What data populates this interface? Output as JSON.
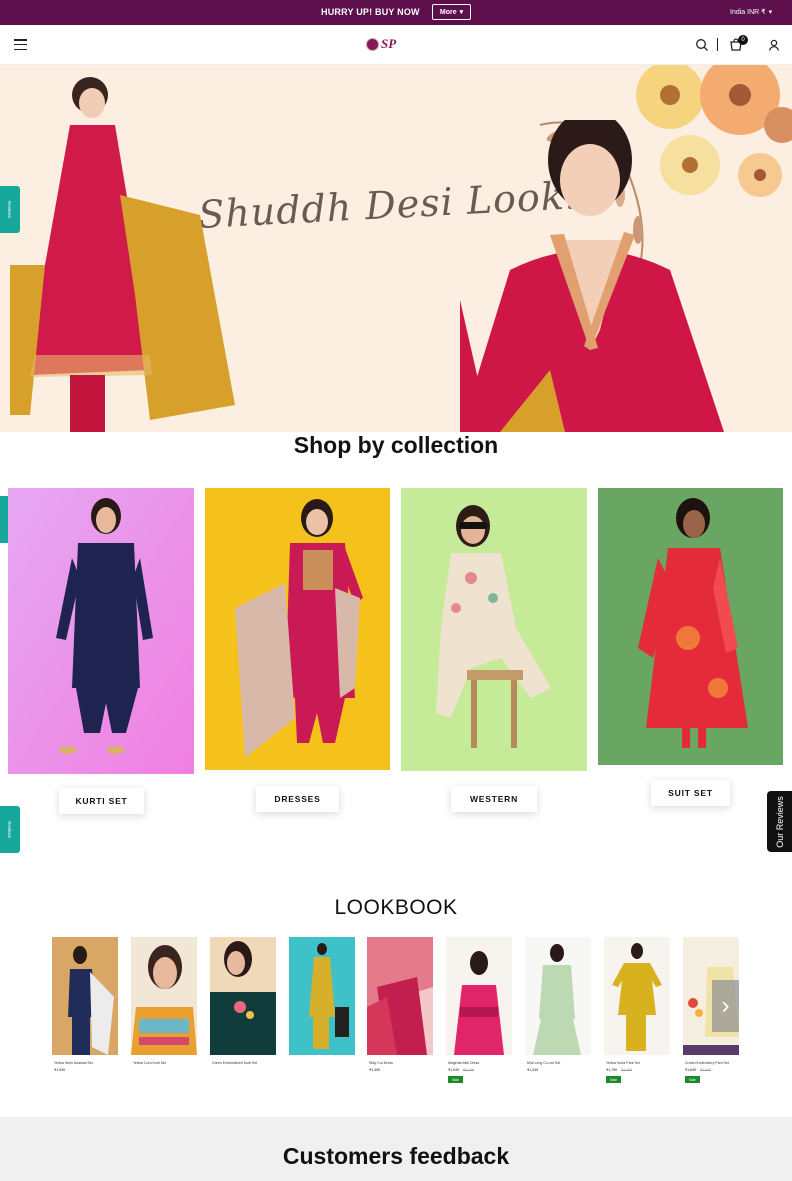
{
  "announcement": {
    "message": "HURRY UP! BUY NOW",
    "more_label": "More",
    "locale": "India INR ₹"
  },
  "header": {
    "logo_text": "SP",
    "cart_count": "0"
  },
  "hero": {
    "headline": "Shuddh Desi Look!",
    "slide_count": 3,
    "active_slide": 2
  },
  "side_tab": {
    "label": "Reviews"
  },
  "collections": {
    "title": "Shop by collection",
    "items": [
      {
        "label": "KURTI SET"
      },
      {
        "label": "DRESSES"
      },
      {
        "label": "WESTERN"
      },
      {
        "label": "SUIT SET"
      }
    ]
  },
  "our_reviews": "Our Reviews",
  "lookbook": {
    "title": "LOOKBOOK",
    "items": [
      {
        "name": "Yellow Work Anarkali Set",
        "price": "₹1,949",
        "mrp": "",
        "badge": ""
      },
      {
        "name": "Yellow Cora Kurti Set",
        "price": "",
        "mrp": "",
        "badge": ""
      },
      {
        "name": "Green Embroidered Kurti Set",
        "price": "",
        "mrp": "",
        "badge": ""
      },
      {
        "name": "",
        "price": "",
        "mrp": "",
        "badge": ""
      },
      {
        "name": "Silky Cut Dress",
        "price": "₹1,499",
        "mrp": "",
        "badge": ""
      },
      {
        "name": "Magenta Midi Dress",
        "price": "₹1,049",
        "mrp": "₹2,049",
        "badge": "Sale"
      },
      {
        "name": "Mint Long Co-ord Set",
        "price": "₹1,049",
        "mrp": "",
        "badge": ""
      },
      {
        "name": "Yellow Kurta Pant Set",
        "price": "₹1,799",
        "mrp": "₹2,799",
        "badge": "Sale"
      },
      {
        "name": "Cream Embroidery Pant Set",
        "price": "₹1,649",
        "mrp": "₹2,649",
        "badge": "Sale"
      }
    ]
  },
  "feedback": {
    "title": "Customers feedback"
  },
  "colors": {
    "announcement_bg": "#5c0f4a",
    "brand": "#8a1859",
    "review_tab": "#15a89b",
    "sale_badge": "#1c8a2c"
  }
}
